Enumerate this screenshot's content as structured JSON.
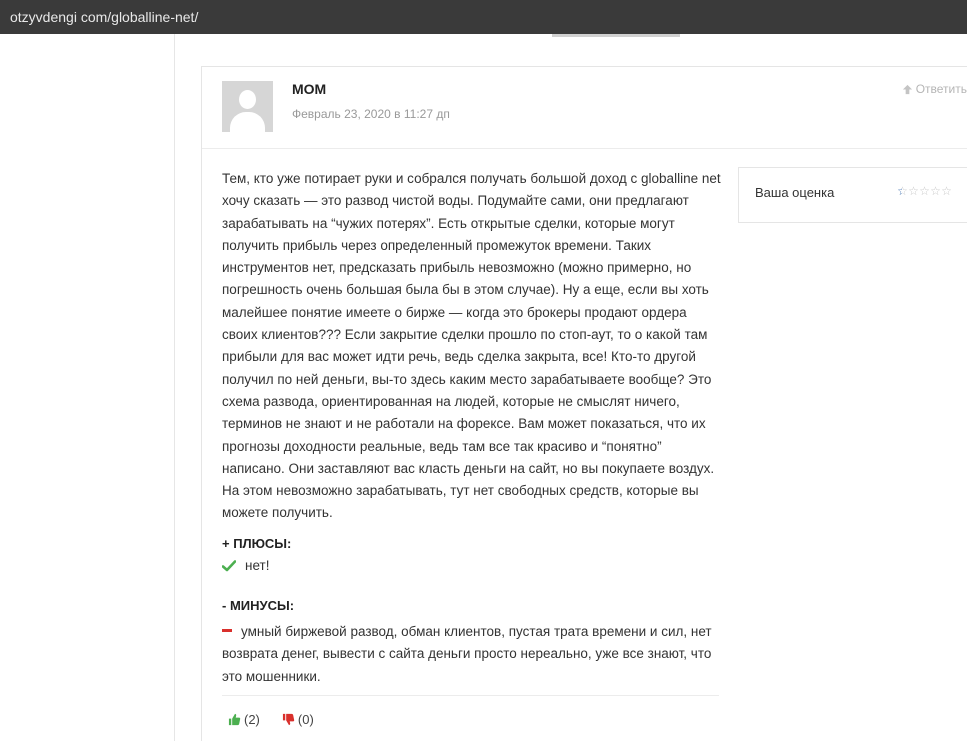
{
  "browser": {
    "url": "otzyvdengi com/globalline-net/"
  },
  "comment": {
    "author": "MOM",
    "date": "Февраль 23, 2020 в 11:27 дп",
    "reply_label": "Ответить",
    "text": "Тем, кто уже потирает руки и собрался получать большой доход с globalline net хочу сказать — это развод чистой воды. Подумайте сами, они предлагают зарабатывать на “чужих потерях”. Есть открытые сделки, которые могут получить прибыль через определенный промежуток времени. Таких инструментов нет, предсказать прибыль невозможно (можно примерно, но погрешность очень большая была бы в этом случае). Ну а еще, если вы хоть малейшее понятие имеете о бирже — когда это брокеры продают ордера своих клиентов??? Если закрытие сделки прошло по стоп-аут, то о какой там прибыли для вас может идти речь, ведь сделка закрыта, все! Кто-то другой получил по ней деньги, вы-то здесь каким место зарабатываете вообще? Это схема развода, ориентированная на людей, которые не смыслят ничего, терминов не знают и не работали на форексе. Вам может показаться, что их прогнозы доходности реальные, ведь там все так красиво и “понятно” написано. Они заставляют вас класть деньги на сайт, но вы покупаете воздух. На этом невозможно зарабатывать, тут нет свободных средств, которые вы можете получить.",
    "pros": {
      "title": "+ ПЛЮСЫ:",
      "item": "нет!"
    },
    "cons": {
      "title": "- МИНУСЫ:",
      "item": "умный биржевой развод, обман клиентов, пустая трата времени и сил, нет возврата денег, вывести с сайта деньги просто нереально, уже все знают, что это мошенники."
    },
    "votes": {
      "up": "(2)",
      "down": "(0)"
    }
  },
  "rating": {
    "label": "Ваша оценка",
    "value": 0.5,
    "max": 5
  },
  "colors": {
    "urlbar": "#3a3a3a",
    "check": "#4caf50",
    "minus": "#d9302c",
    "thumb_up": "#4caf50",
    "thumb_down": "#d9302c",
    "star_fill": "#3f6fb0"
  }
}
